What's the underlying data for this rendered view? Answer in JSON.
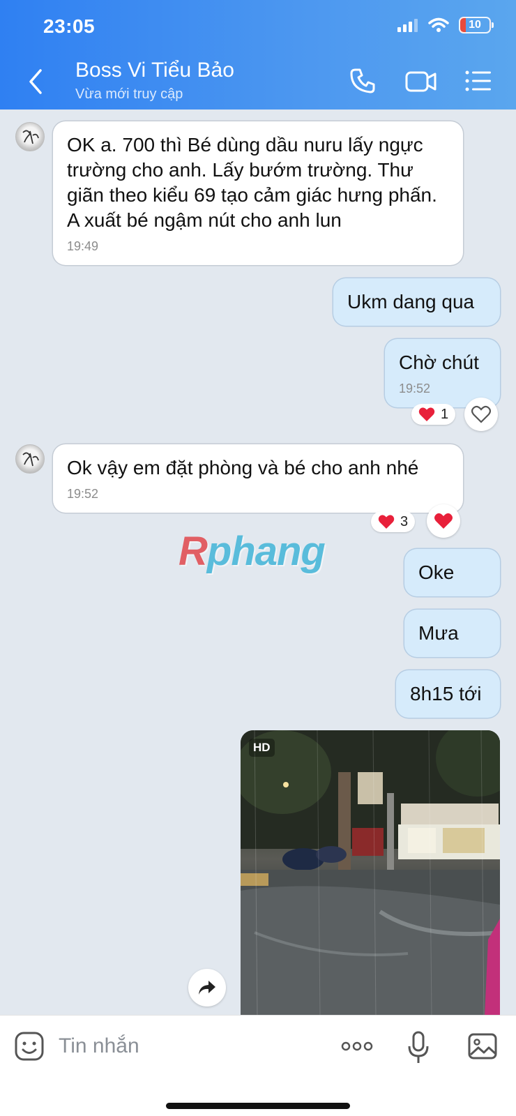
{
  "status_bar": {
    "time": "23:05",
    "battery": "10"
  },
  "header": {
    "contact_name": "Boss Vi Tiểu Bảo",
    "contact_status": "Vừa mới truy cập"
  },
  "messages": [
    {
      "from": "them",
      "text": "OK a. 700 thì Bé dùng dầu nuru lấy ngực trường cho anh. Lấy bướm trường. Thư giãn theo kiểu 69 tạo cảm giác hưng phấn. A xuất bé ngậm nút cho anh lun",
      "time": "19:49"
    },
    {
      "from": "me",
      "text": "Ukm dang qua"
    },
    {
      "from": "me",
      "text": "Chờ chút",
      "time": "19:52",
      "reaction_count": "1"
    },
    {
      "from": "them",
      "text": "Ok vậy em đặt phòng và bé cho anh nhé",
      "time": "19:52",
      "reaction_count": "3"
    },
    {
      "from": "me",
      "text": "Oke"
    },
    {
      "from": "me",
      "text": "Mưa"
    },
    {
      "from": "me",
      "text": "8h15 tới"
    },
    {
      "from": "me",
      "type": "photo",
      "badge": "HD"
    }
  ],
  "watermark": {
    "first": "R",
    "rest": "phang"
  },
  "composer": {
    "placeholder": "Tin nhắn"
  },
  "colors": {
    "header_start": "#2f80f2",
    "header_end": "#5aa6ee",
    "outgoing_bubble": "#d6ebfb",
    "chat_bg": "#e2e8ef",
    "heart": "#e8203a"
  }
}
